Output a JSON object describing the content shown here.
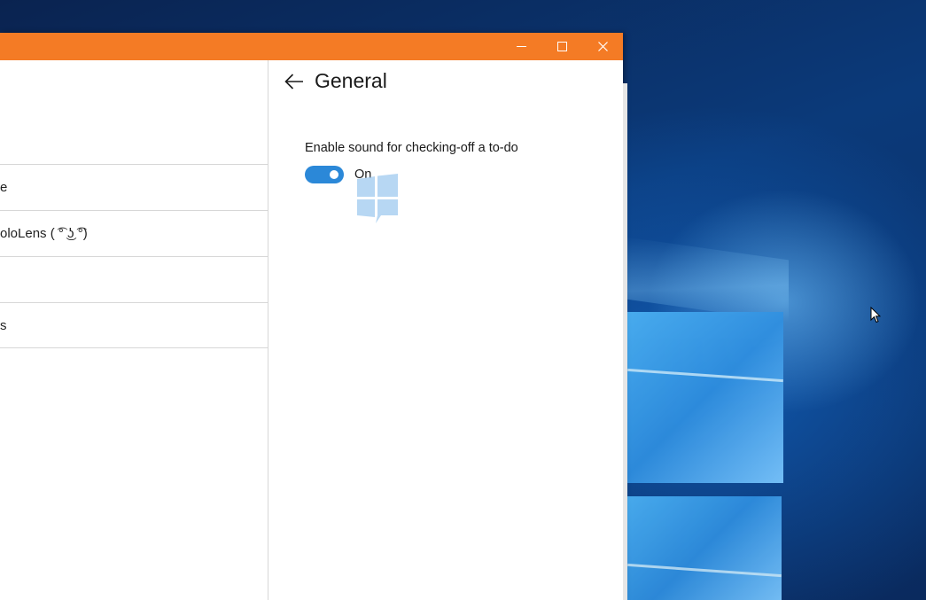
{
  "window": {
    "titlebar_color": "#f47b25",
    "controls": [
      "minimize-icon",
      "maximize-icon",
      "close-icon"
    ]
  },
  "sidebar": {
    "items": [
      {
        "label": "e"
      },
      {
        "label": "oloLens ( ͡° ͜ʖ ͡°)"
      },
      {
        "label": ""
      },
      {
        "label": "s"
      }
    ]
  },
  "settings": {
    "back_icon": "back-arrow-icon",
    "title": "General",
    "setting_label": "Enable sound for checking-off a to-do",
    "toggle": {
      "state": "On",
      "checked": true,
      "accent": "#2b88d8"
    }
  },
  "desktop": {
    "wallpaper": "windows-10-hero",
    "accent": "#2f8fe0"
  }
}
